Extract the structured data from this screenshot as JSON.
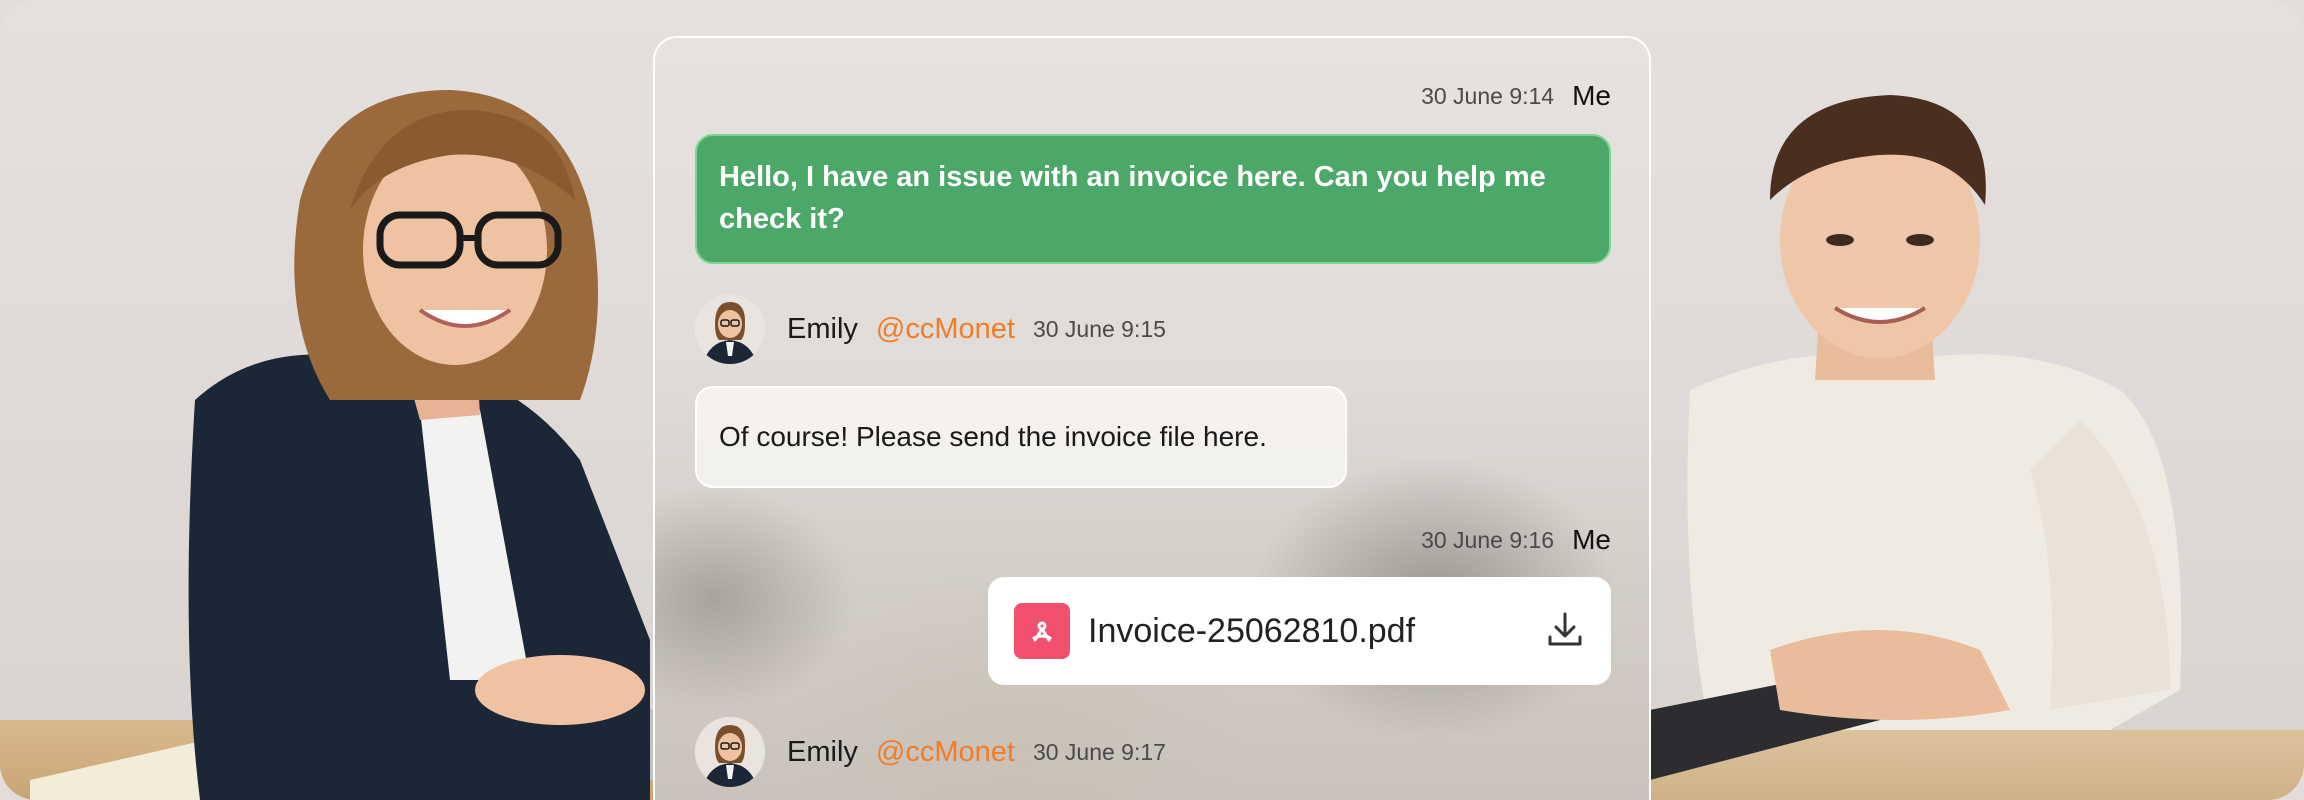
{
  "chat": {
    "messages": [
      {
        "time": "30 June 9:14",
        "sender": "Me",
        "text": "Hello, I have an issue with an invoice here. Can you help me check it?"
      },
      {
        "sender": "Emily",
        "handle": "@ccMonet",
        "time": "30 June 9:15",
        "text": "Of course! Please send the invoice file here."
      },
      {
        "time": "30 June 9:16",
        "sender": "Me",
        "file_name": "Invoice-25062810.pdf",
        "file_icon": "pdf-icon",
        "action_icon": "download-icon"
      },
      {
        "sender": "Emily",
        "handle": "@ccMonet",
        "time": "30 June 9:17"
      }
    ]
  },
  "colors": {
    "my_bubble": "#4ba869",
    "handle": "#f07d2a",
    "pdf_icon": "#f0506e"
  }
}
